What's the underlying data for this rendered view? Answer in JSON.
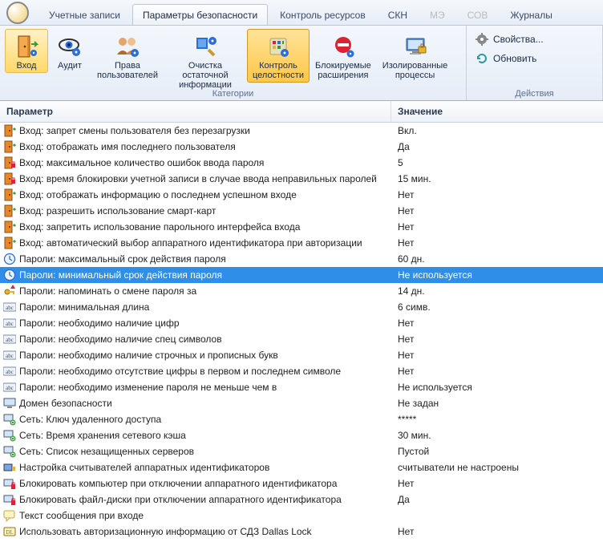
{
  "tabs": [
    {
      "label": "Учетные записи",
      "state": "normal"
    },
    {
      "label": "Параметры безопасности",
      "state": "active"
    },
    {
      "label": "Контроль ресурсов",
      "state": "normal"
    },
    {
      "label": "СКН",
      "state": "normal"
    },
    {
      "label": "МЭ",
      "state": "disabled"
    },
    {
      "label": "СОВ",
      "state": "disabled"
    },
    {
      "label": "Журналы",
      "state": "normal"
    }
  ],
  "ribbon": {
    "group_categories_title": "Категории",
    "group_actions_title": "Действия",
    "login_label": "Вход",
    "audit_label": "Аудит",
    "user_rights_label": "Права\nпользователей",
    "cleanup_label": "Очистка остаточной\nинформации",
    "integrity_label": "Контроль\nцелостности",
    "blocked_ext_label": "Блокируемые\nрасширения",
    "isolated_proc_label": "Изолированные\nпроцессы",
    "properties_label": "Свойства...",
    "refresh_label": "Обновить"
  },
  "columns": {
    "param": "Параметр",
    "value": "Значение"
  },
  "rows": [
    {
      "icon": "door",
      "param": "Вход: запрет смены пользователя без перезагрузки",
      "value": "Вкл."
    },
    {
      "icon": "door",
      "param": "Вход: отображать имя последнего пользователя",
      "value": "Да"
    },
    {
      "icon": "door-lock",
      "param": "Вход: максимальное количество ошибок ввода пароля",
      "value": "5"
    },
    {
      "icon": "door-lock",
      "param": "Вход: время блокировки учетной записи в случае ввода неправильных паролей",
      "value": "15 мин."
    },
    {
      "icon": "door",
      "param": "Вход: отображать информацию о последнем успешном входе",
      "value": "Нет"
    },
    {
      "icon": "door",
      "param": "Вход: разрешить использование смарт-карт",
      "value": "Нет"
    },
    {
      "icon": "door",
      "param": "Вход: запретить использование парольного интерфейса входа",
      "value": "Нет"
    },
    {
      "icon": "door",
      "param": "Вход: автоматический выбор аппаратного идентификатора при авторизации",
      "value": "Нет"
    },
    {
      "icon": "clock",
      "param": "Пароли: максимальный срок действия пароля",
      "value": "60 дн."
    },
    {
      "icon": "clock",
      "param": "Пароли: минимальный срок действия пароля",
      "value": "Не используется",
      "selected": true
    },
    {
      "icon": "key-warn",
      "param": "Пароли: напоминать о смене пароля за",
      "value": "14 дн."
    },
    {
      "icon": "abc",
      "param": "Пароли: минимальная длина",
      "value": "6 симв."
    },
    {
      "icon": "abc",
      "param": "Пароли: необходимо наличие цифр",
      "value": "Нет"
    },
    {
      "icon": "abc",
      "param": "Пароли: необходимо наличие спец символов",
      "value": "Нет"
    },
    {
      "icon": "abc",
      "param": "Пароли: необходимо наличие строчных и прописных букв",
      "value": "Нет"
    },
    {
      "icon": "abc",
      "param": "Пароли: необходимо отсутствие цифры в первом и последнем символе",
      "value": "Нет"
    },
    {
      "icon": "abc",
      "param": "Пароли: необходимо изменение пароля не меньше чем в",
      "value": "Не используется"
    },
    {
      "icon": "monitor",
      "param": "Домен безопасности",
      "value": "Не задан"
    },
    {
      "icon": "net",
      "param": "Сеть: Ключ удаленного доступа",
      "value": "*****"
    },
    {
      "icon": "net",
      "param": "Сеть: Время хранения сетевого кэша",
      "value": "30 мин."
    },
    {
      "icon": "net",
      "param": "Сеть: Список незащищенных серверов",
      "value": "Пустой"
    },
    {
      "icon": "reader",
      "param": "Настройка считывателей аппаратных идентификаторов",
      "value": "считыватели не настроены"
    },
    {
      "icon": "plug-red",
      "param": "Блокировать компьютер при отключении аппаратного идентификатора",
      "value": "Нет"
    },
    {
      "icon": "plug-red",
      "param": "Блокировать файл-диски при отключении аппаратного идентификатора",
      "value": "Да"
    },
    {
      "icon": "chat",
      "param": "Текст сообщения при входе",
      "value": ""
    },
    {
      "icon": "dl",
      "param": "Использовать авторизационную информацию от СДЗ Dallas Lock",
      "value": "Нет"
    }
  ]
}
